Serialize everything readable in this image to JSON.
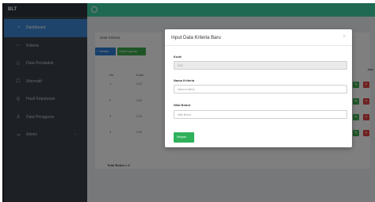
{
  "app": {
    "brand": "BLT"
  },
  "sidebar": {
    "items": [
      {
        "label": "Dashboard",
        "icon": "gauge-icon",
        "glyph": "◔"
      },
      {
        "label": "Kriteria",
        "icon": "dots-icon",
        "glyph": "⋯"
      },
      {
        "label": "Data Penduduk",
        "icon": "people-icon",
        "glyph": "⚇"
      },
      {
        "label": "Alternatif",
        "icon": "box-icon",
        "glyph": "☐"
      },
      {
        "label": "Hasil Keputusan",
        "icon": "search-icon",
        "glyph": "⚲"
      },
      {
        "label": "Data Pengguna",
        "icon": "user-icon",
        "glyph": "♙"
      },
      {
        "label": "Admin",
        "icon": "key-icon",
        "glyph": "⊸"
      }
    ]
  },
  "main": {
    "panel_title": "Data Kriteria",
    "add_button": "+ Tambah",
    "print_button": "Cetak Laporan",
    "headers": [
      "No",
      "Kode",
      "Aksi"
    ],
    "rows": [
      {
        "no": "1",
        "kode": "C01"
      },
      {
        "no": "2",
        "kode": "C02"
      },
      {
        "no": "3",
        "kode": "C03"
      },
      {
        "no": "4",
        "kode": "C04"
      }
    ],
    "total": "Total Bobot = 0"
  },
  "modal": {
    "title": "Input Data Kriteria Baru",
    "close": "×",
    "fields": {
      "kode": {
        "label": "Kode",
        "value": "C05"
      },
      "nama": {
        "label": "Nama Kriteria",
        "placeholder": "Nama Kriteria"
      },
      "bobot": {
        "label": "Nilai Bobot",
        "placeholder": "Nilai Bobot"
      }
    },
    "save_button": "Simpan"
  },
  "colors": {
    "topbar": "#3fd1a4",
    "sidebar": "#3a434c",
    "active": "#3e88d6",
    "save": "#2fb15b",
    "delete": "#e04242"
  }
}
